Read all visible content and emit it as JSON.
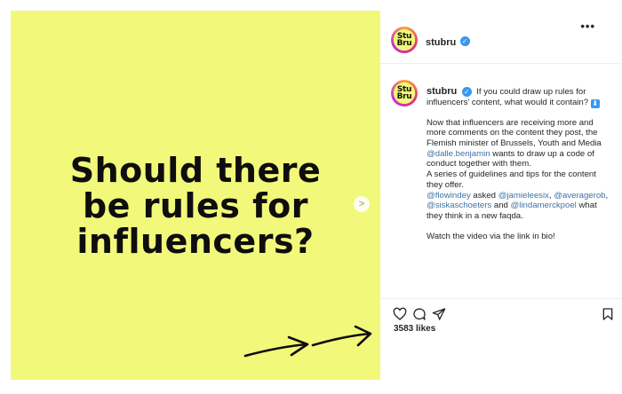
{
  "post": {
    "headline": [
      "Should there",
      "be rules for",
      "influencers?"
    ]
  },
  "header": {
    "avatar_text": [
      "Stu",
      "Bru"
    ],
    "username": "stubru",
    "more_label": "•••"
  },
  "caption": {
    "username": "stubru",
    "intro": "If you could draw up rules for influencers' content, what would it contain?",
    "intro_emoji": "⬇",
    "p2_before": "Now that influencers are receiving more and more comments on the content they post, the Flemish minister of Brussels, Youth and Media ",
    "p2_mention": "@dalle.benjamin",
    "p2_after": " wants to draw up a code of conduct together with them.",
    "p3": "A series of guidelines and tips for the content they offer.",
    "p4_m1": "@flowindey",
    "p4_t1": " asked ",
    "p4_m2": "@jamieleesix",
    "p4_t2": ", ",
    "p4_m3": "@averagerob",
    "p4_t3": ", ",
    "p4_m4": "@siskaschoeters",
    "p4_t4": " and ",
    "p4_m5": "@lindamerckpoel",
    "p4_t5": " what they think in a new faqda.",
    "p5": "Watch the video via the link in bio!"
  },
  "actions": {
    "likes": "3583 likes"
  },
  "icons": {
    "like": "heart-icon",
    "comment": "comment-icon",
    "share": "send-icon",
    "save": "bookmark-icon",
    "verified": "verified-badge-icon",
    "next": "chevron-right-icon"
  },
  "colors": {
    "post_background": "#f2f87a",
    "link": "#3f73a6",
    "verified": "#3897f0"
  }
}
